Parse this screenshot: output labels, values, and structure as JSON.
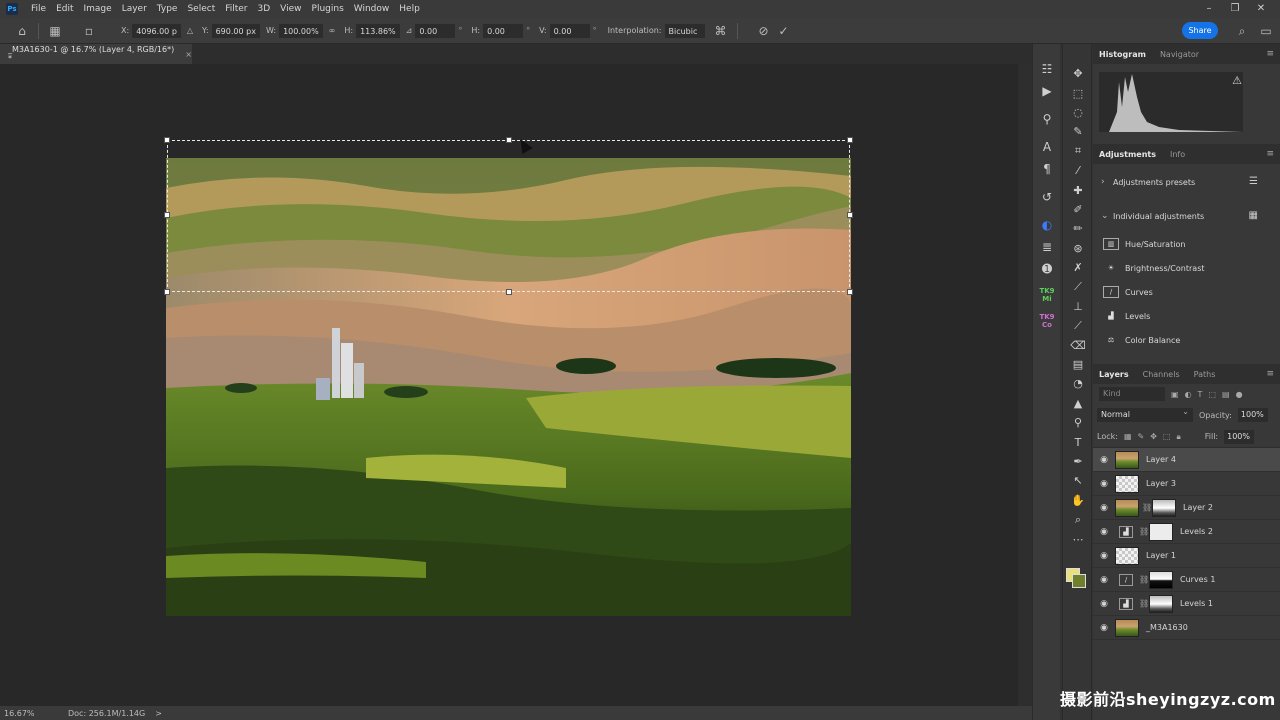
{
  "app": {
    "logo_text": "Ps",
    "menu": [
      "File",
      "Edit",
      "Image",
      "Layer",
      "Type",
      "Select",
      "Filter",
      "3D",
      "View",
      "Plugins",
      "Window",
      "Help"
    ]
  },
  "options": {
    "x_label": "X:",
    "x_value": "4096.00 p",
    "y_label": "Y:",
    "y_value": "690.00 px",
    "w_label": "W:",
    "w_value": "100.00%",
    "h_label": "H:",
    "h_value": "113.86%",
    "angle_value": "0.00",
    "hskew_label": "H:",
    "hskew_value": "0.00",
    "vskew_label": "V:",
    "vskew_value": "0.00",
    "degree_unit": "°",
    "interp_label": "Interpolation:",
    "interp_value": "Bicubic",
    "share_label": "Share"
  },
  "document": {
    "tab_title": "_M3A1630-1 @ 16.7% (Layer 4, RGB/16*) *",
    "tab_close": "×"
  },
  "status": {
    "zoom": "16.67%",
    "doc": "Doc: 256.1M/1.14G",
    "arrow": ">"
  },
  "panels": {
    "histogram_tab": "Histogram",
    "navigator_tab": "Navigator",
    "adjustments_tab": "Adjustments",
    "info_tab": "Info",
    "adj_presets": "Adjustments presets",
    "individual_adj": "Individual adjustments",
    "adj_items": [
      "Hue/Saturation",
      "Brightness/Contrast",
      "Curves",
      "Levels",
      "Color Balance"
    ],
    "layers_tab": "Layers",
    "channels_tab": "Channels",
    "paths_tab": "Paths",
    "kind_placeholder": "Kind",
    "blend_mode": "Normal",
    "opacity_label": "Opacity:",
    "opacity_value": "100%",
    "lock_label": "Lock:",
    "fill_label": "Fill:",
    "fill_value": "100%",
    "layers": [
      "Layer 4",
      "Layer 3",
      "Layer 2",
      "Levels 2",
      "Layer 1",
      "Curves 1",
      "Levels 1",
      "_M3A1630"
    ]
  },
  "watermark": "摄影前沿sheyingzyz.com",
  "colors": {
    "accent": "#1473e6",
    "foreground_swatch": "#e8e07a",
    "background_swatch": "#6f7f2c"
  }
}
